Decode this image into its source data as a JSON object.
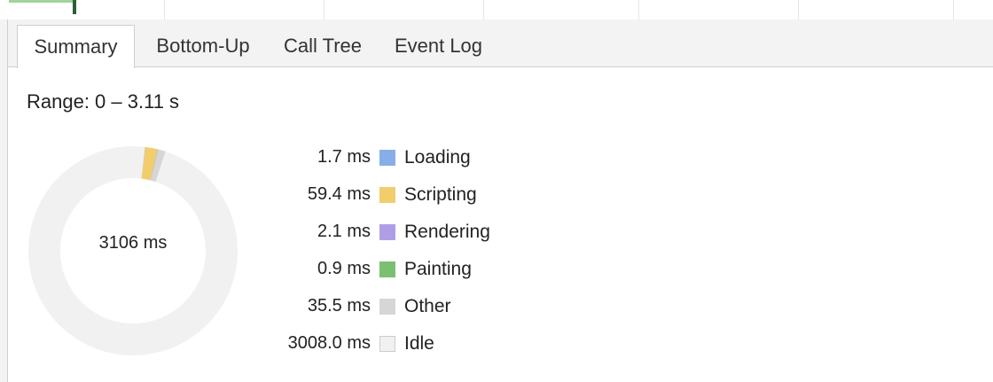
{
  "tabs": [
    "Summary",
    "Bottom-Up",
    "Call Tree",
    "Event Log"
  ],
  "active_tab": "Summary",
  "range_text": "Range: 0 – 3.11 s",
  "donut_center_text": "3106 ms",
  "colors": {
    "loading": "#87aee8",
    "scripting": "#f2cd6b",
    "rendering": "#af9ee6",
    "painting": "#7bbf73",
    "other": "#d6d6d6",
    "idle": "#f1f1f1"
  },
  "legend": [
    {
      "value": "1.7 ms",
      "label": "Loading",
      "color": "#87aee8",
      "ms": 1.7
    },
    {
      "value": "59.4 ms",
      "label": "Scripting",
      "color": "#f2cd6b",
      "ms": 59.4
    },
    {
      "value": "2.1 ms",
      "label": "Rendering",
      "color": "#af9ee6",
      "ms": 2.1
    },
    {
      "value": "0.9 ms",
      "label": "Painting",
      "color": "#7bbf73",
      "ms": 0.9
    },
    {
      "value": "35.5 ms",
      "label": "Other",
      "color": "#d6d6d6",
      "ms": 35.5
    },
    {
      "value": "3008.0 ms",
      "label": "Idle",
      "color": "#f1f1f1",
      "ms": 3008.0
    }
  ]
}
